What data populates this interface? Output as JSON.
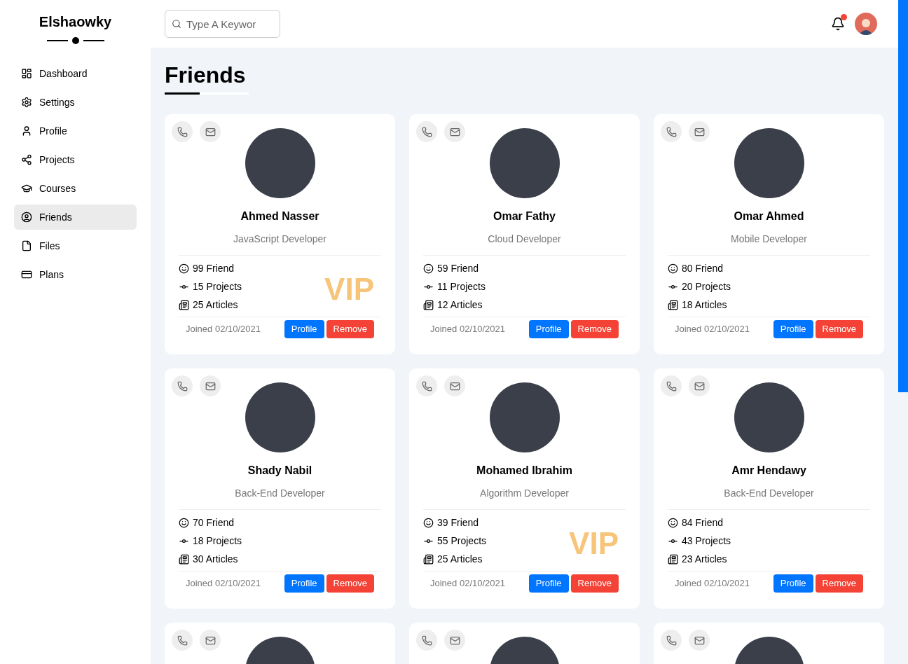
{
  "sidebar": {
    "title": "Elshaowky",
    "items": [
      {
        "label": "Dashboard",
        "selected": false
      },
      {
        "label": "Settings",
        "selected": false
      },
      {
        "label": "Profile",
        "selected": false
      },
      {
        "label": "Projects",
        "selected": false
      },
      {
        "label": "Courses",
        "selected": false
      },
      {
        "label": "Friends",
        "selected": true
      },
      {
        "label": "Files",
        "selected": false
      },
      {
        "label": "Plans",
        "selected": false
      }
    ]
  },
  "header": {
    "search": {
      "placeholder": "Type A Keywor"
    },
    "notification": true
  },
  "page_title": "Friends",
  "cards": [
    {
      "name": "Ahmed Nasser",
      "role": "JavaScript Developer",
      "friends": "99 Friend",
      "projects": "15 Projects",
      "articles": "25 Articles",
      "vip_badge": "VIP",
      "joined": "Joined 02/10/2021",
      "profile": "Profile",
      "remove": "Remove"
    },
    {
      "name": "Omar Fathy",
      "role": "Cloud Developer",
      "friends": "59 Friend",
      "projects": "11 Projects",
      "articles": "12 Articles",
      "joined": "Joined 02/10/2021",
      "profile": "Profile",
      "remove": "Remove"
    },
    {
      "name": "Omar Ahmed",
      "role": "Mobile Developer",
      "friends": "80 Friend",
      "projects": "20 Projects",
      "articles": "18 Articles",
      "joined": "Joined 02/10/2021",
      "profile": "Profile",
      "remove": "Remove"
    },
    {
      "name": "Shady Nabil",
      "role": "Back-End Developer",
      "friends": "70 Friend",
      "projects": "18 Projects",
      "articles": "30 Articles",
      "joined": "Joined 02/10/2021",
      "profile": "Profile",
      "remove": "Remove"
    },
    {
      "name": "Mohamed Ibrahim",
      "role": "Algorithm Developer",
      "friends": "39 Friend",
      "projects": "55 Projects",
      "articles": "25 Articles",
      "vip_badge": "VIP",
      "joined": "Joined 02/10/2021",
      "profile": "Profile",
      "remove": "Remove"
    },
    {
      "name": "Amr Hendawy",
      "role": "Back-End Developer",
      "friends": "84 Friend",
      "projects": "43 Projects",
      "articles": "23 Articles",
      "joined": "Joined 02/10/2021",
      "profile": "Profile",
      "remove": "Remove"
    }
  ],
  "partial_cards": [
    {
      "kind": "cut-off"
    },
    {
      "kind": "cut-off"
    },
    {
      "kind": "cut-off"
    }
  ]
}
